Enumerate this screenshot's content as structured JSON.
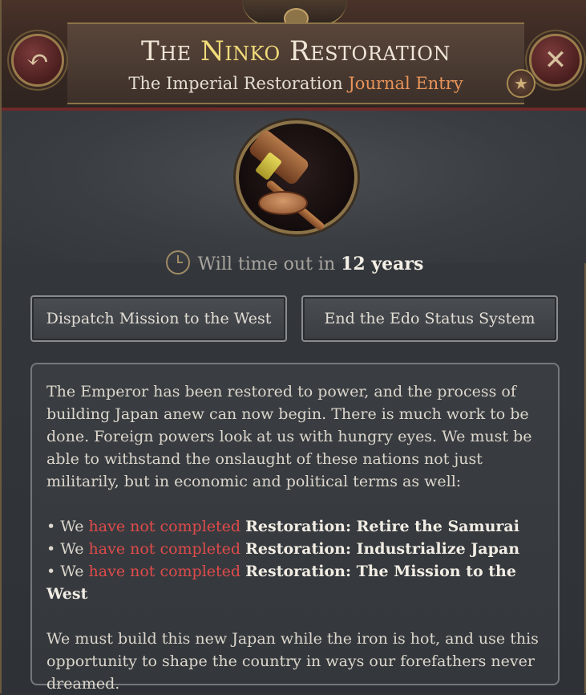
{
  "header": {
    "title_prefix": "The ",
    "title_name": "Ninko",
    "title_suffix": " Restoration",
    "subtitle_main": "The Imperial Restoration",
    "subtitle_accent": "Journal Entry"
  },
  "icons": {
    "back": "↶",
    "close": "✕",
    "star": "★"
  },
  "timeout": {
    "prefix": "Will time out in",
    "value": "12 years"
  },
  "actions": {
    "left": "Dispatch Mission to the West",
    "right": "End the Edo Status System"
  },
  "description": {
    "intro": "The Emperor has been restored to power, and the process of building Japan anew can now begin. There is much work to be done. Foreign powers look at us with hungry eyes. We must be able to withstand the onslaught of these nations not just militarily, but in economic and political terms as well:",
    "requirements": [
      {
        "prefix": "• We ",
        "status": "have not completed",
        "goal": "Restoration: Retire the Samurai"
      },
      {
        "prefix": "• We ",
        "status": "have not completed",
        "goal": "Restoration: Industrialize Japan"
      },
      {
        "prefix": "• We ",
        "status": "have not completed",
        "goal": "Restoration: The Mission to the West"
      }
    ],
    "outro": "We must build this new Japan while the iron is hot, and use this opportunity to shape the country in ways our forefathers never dreamed."
  },
  "colors": {
    "accent_orange": "#e9945a",
    "title_gold": "#f2dc7a",
    "status_red": "#e04a4a"
  }
}
